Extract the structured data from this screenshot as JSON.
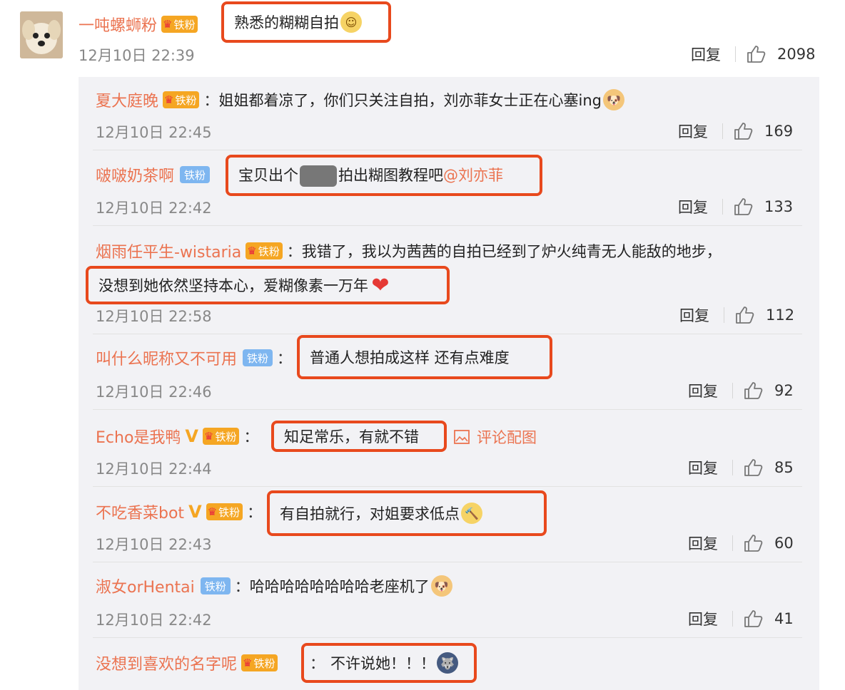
{
  "top_comment": {
    "username": "一吨螺蛳粉",
    "badge": "铁粉",
    "badge_level": "4",
    "text": "熟悉的糊糊自拍",
    "emoji": "shy-face-emoji",
    "time": "12月10日 22:39",
    "reply_label": "回复",
    "likes": "2098"
  },
  "replies": [
    {
      "username": "夏大庭晚",
      "badge": "铁粉",
      "badge_level": "1",
      "text": "姐姐都着凉了，你们只关注自拍，刘亦菲女士正在心塞ing",
      "emoji": "doge-emoji",
      "time": "12月10日 22:45",
      "reply_label": "回复",
      "likes": "169"
    },
    {
      "username": "啵啵奶茶啊",
      "badge": "铁粉",
      "text_a": "宝贝出个",
      "text_b": "拍出糊图教程吧",
      "mention": "@刘亦菲",
      "time": "12月10日 22:42",
      "reply_label": "回复",
      "likes": "133"
    },
    {
      "username": "烟雨任平生-wistaria",
      "badge": "铁粉",
      "badge_level": "5",
      "text_line1": "我错了，我以为茜茜的自拍已经到了炉火纯青无人能敌的地步，",
      "text_line2": "没想到她依然坚持本心，爱糊像素一万年",
      "emoji": "heart-emoji",
      "time": "12月10日 22:58",
      "reply_label": "回复",
      "likes": "112"
    },
    {
      "username": "叫什么昵称又不可用",
      "badge": "铁粉",
      "text": "普通人想拍成这样 还有点难度",
      "time": "12月10日 22:46",
      "reply_label": "回复",
      "likes": "92"
    },
    {
      "username": "Echo是我鸭",
      "verified": "V",
      "badge": "铁粉",
      "badge_level": "3",
      "text": "知足常乐，有就不错",
      "picture_link": "评论配图",
      "time": "12月10日 22:44",
      "reply_label": "回复",
      "likes": "85"
    },
    {
      "username": "不吃香菜bot",
      "verified": "V",
      "badge": "铁粉",
      "badge_level": "2",
      "text": "有自拍就行，对姐要求低点",
      "emoji": "hammer-face-emoji",
      "time": "12月10日 22:43",
      "reply_label": "回复",
      "likes": "60"
    },
    {
      "username": "淑女orHentai",
      "badge": "铁粉",
      "text": "哈哈哈哈哈哈哈哈老座机了",
      "emoji": "doge-emoji",
      "time": "12月10日 22:42",
      "reply_label": "回复",
      "likes": "41"
    },
    {
      "username": "没想到喜欢的名字呢",
      "badge": "铁粉",
      "badge_level": "1",
      "text": "不许说她！！！",
      "emoji": "husky-emoji"
    }
  ],
  "colon": "：",
  "colors": {
    "username": "#eb7350",
    "highlight": "#e8491d",
    "badge_gold": "#f5a623",
    "badge_blue": "#7eb6f0",
    "subbox_bg": "#f2f2f5",
    "time": "#888888"
  }
}
